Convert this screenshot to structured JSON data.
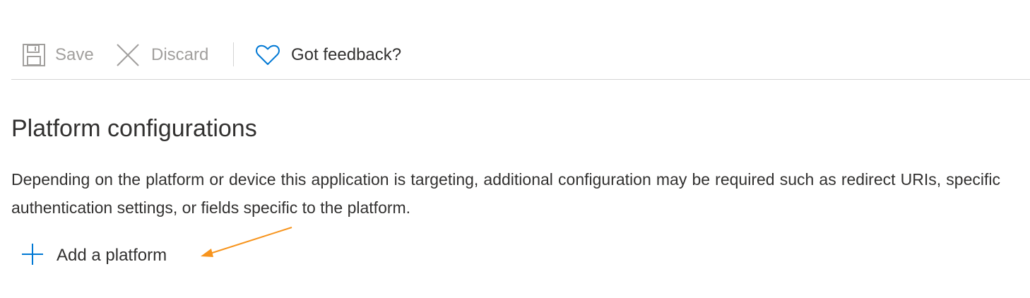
{
  "toolbar": {
    "save_label": "Save",
    "discard_label": "Discard",
    "feedback_label": "Got feedback?",
    "icons": {
      "save": "save-floppy-icon",
      "discard": "close-x-icon",
      "feedback": "heart-icon"
    }
  },
  "section": {
    "title": "Platform configurations",
    "description": "Depending on the platform or device this application is targeting, additional configuration may be required such as redirect URIs, specific authentication settings, or fields specific to the platform."
  },
  "actions": {
    "add_platform_label": "Add a platform",
    "add_platform_icon": "plus-icon"
  },
  "colors": {
    "accent": "#0078d4",
    "disabled": "#a19f9d",
    "text": "#323130",
    "annotation": "#f7941d"
  }
}
